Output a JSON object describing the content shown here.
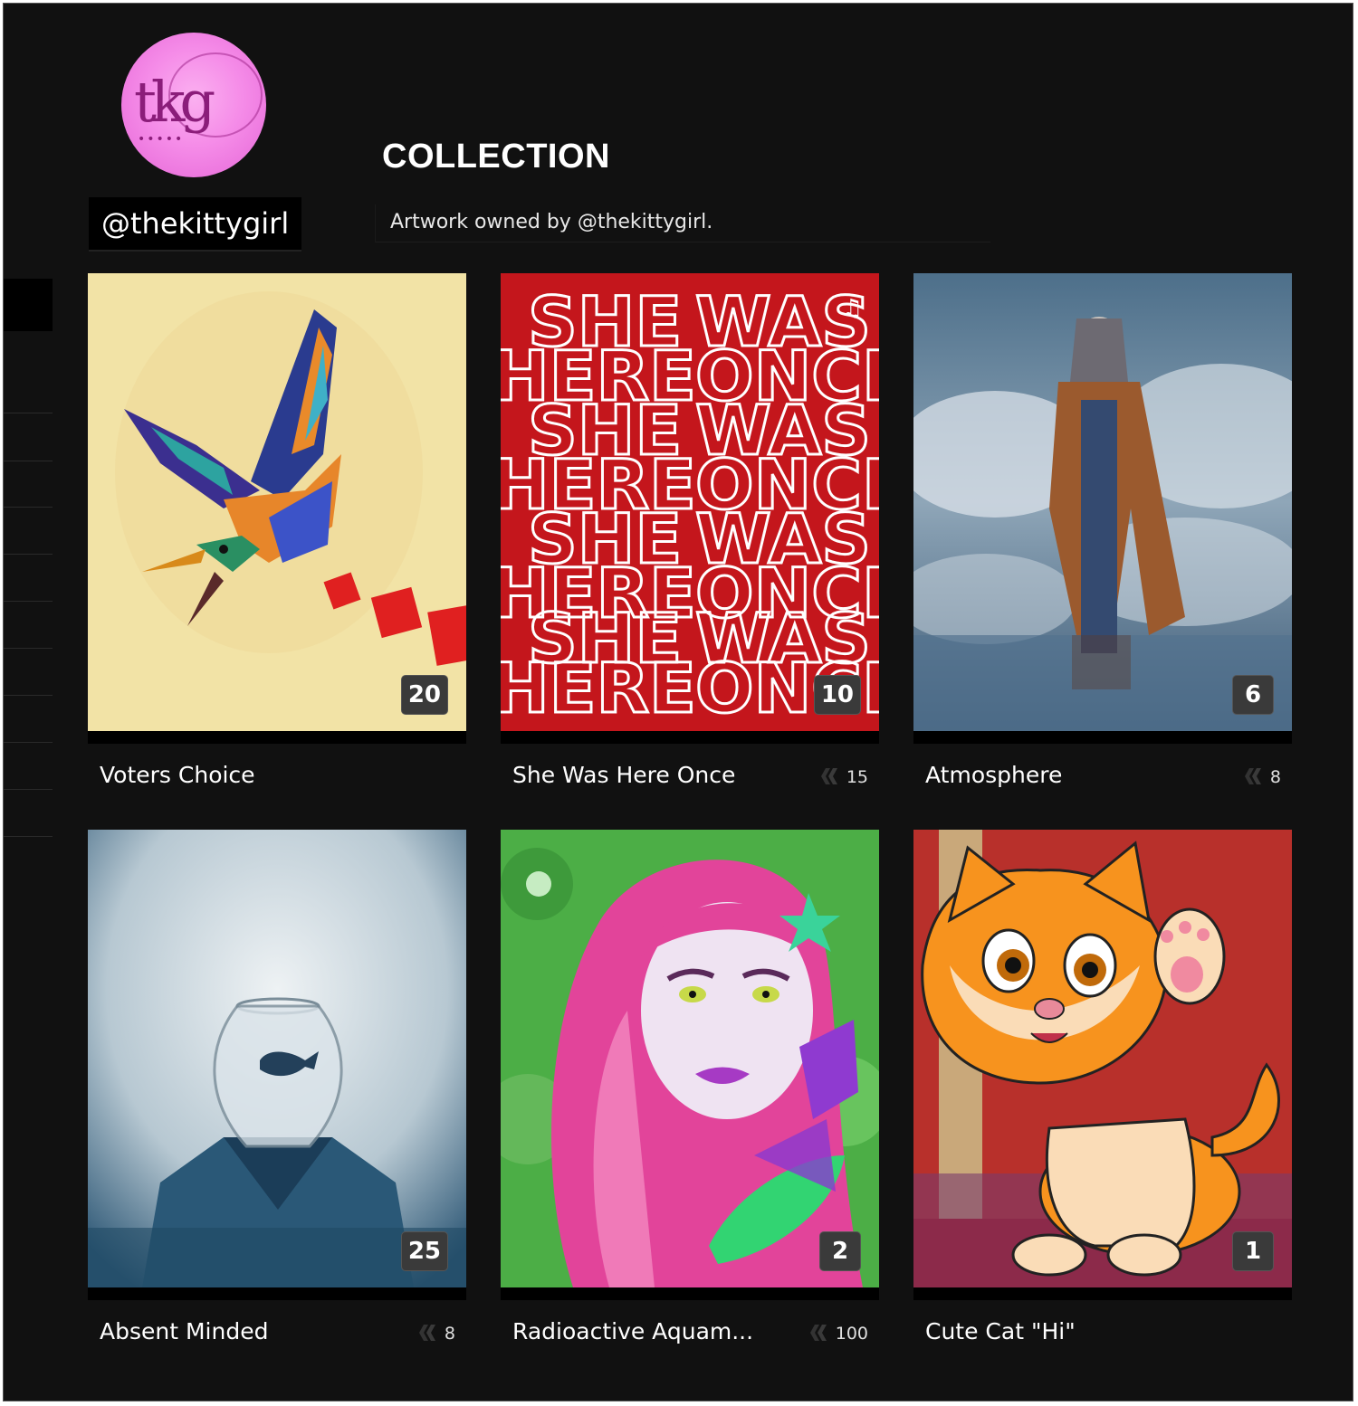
{
  "profile": {
    "logo_text": "tkg",
    "logo_dots": "•••••",
    "username": "@thekittygirl"
  },
  "header": {
    "title": "COLLECTION",
    "subtitle": "Artwork owned by @thekittygirl."
  },
  "cards": [
    {
      "title": "Voters Choice",
      "count": "20",
      "price": ""
    },
    {
      "title": "She Was Here Once",
      "count": "10",
      "price": "15",
      "art_text": [
        "SHE",
        "WAS",
        "HERE",
        "ONCE"
      ]
    },
    {
      "title": "Atmosphere",
      "count": "6",
      "price": "8"
    },
    {
      "title": "Absent Minded",
      "count": "25",
      "price": "8"
    },
    {
      "title": "Radioactive Aquam...",
      "count": "2",
      "price": "100"
    },
    {
      "title": "Cute Cat \"Hi\"",
      "count": "1",
      "price": ""
    }
  ],
  "colors": {
    "background": "#111111",
    "card_text": "#ffffff",
    "logo_pink": "#f58ce8",
    "logo_text": "#8b1d7a"
  }
}
